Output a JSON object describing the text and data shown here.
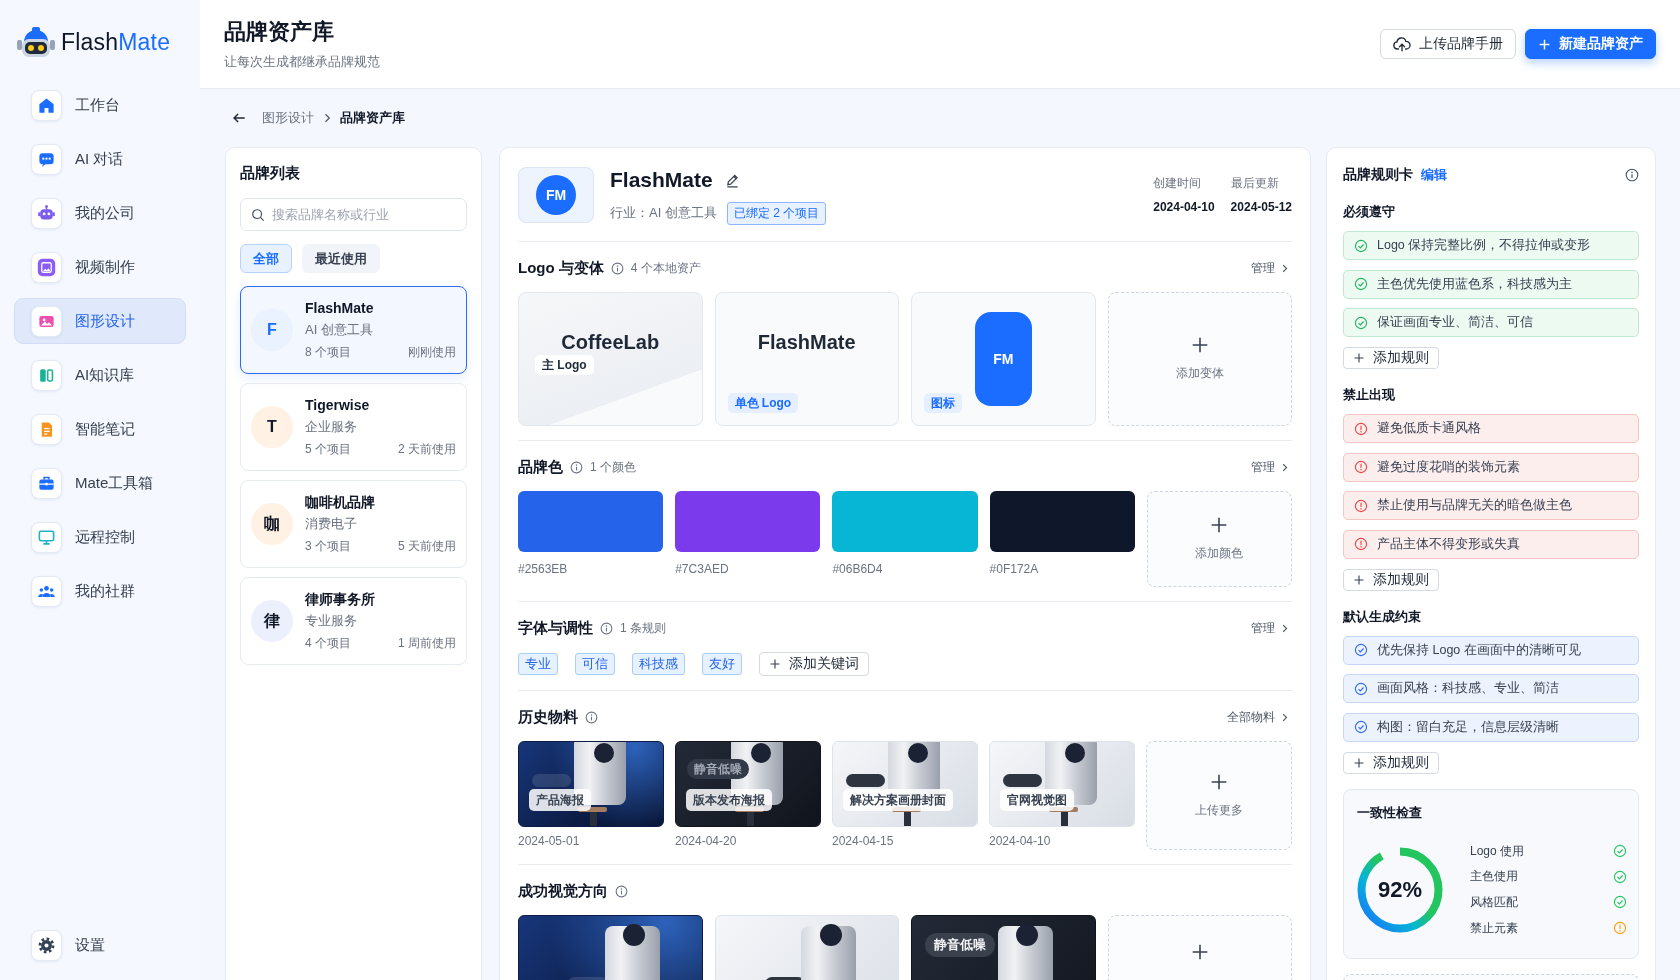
{
  "sidebar": {
    "logo": {
      "name_start": "Flash",
      "name_end": "Mate"
    },
    "items": [
      {
        "label": "工作台",
        "selected": false
      },
      {
        "label": "AI 对话",
        "selected": false
      },
      {
        "label": "我的公司",
        "selected": false
      },
      {
        "label": "视频制作",
        "selected": false
      },
      {
        "label": "图形设计",
        "selected": true
      },
      {
        "label": "AI知识库",
        "selected": false
      },
      {
        "label": "智能笔记",
        "selected": false
      },
      {
        "label": "Mate工具箱",
        "selected": false
      },
      {
        "label": "远程控制",
        "selected": false
      },
      {
        "label": "我的社群",
        "selected": false
      }
    ],
    "settings": {
      "label": "设置"
    }
  },
  "header": {
    "title": "品牌资产库",
    "subtitle": "让每次生成都继承品牌规范",
    "buttons": [
      {
        "kind": "upload",
        "label": "上传品牌手册"
      },
      {
        "kind": "create",
        "label": "新建品牌资产"
      }
    ]
  },
  "breadcrumb": [
    {
      "label": "图形设计",
      "current": false
    },
    {
      "label": "品牌资产库",
      "current": true
    }
  ],
  "brand_list": {
    "title": "品牌列表",
    "search": {
      "placeholder": "搜索品牌名称或行业"
    },
    "filters": [
      {
        "label": "全部",
        "selected": true
      },
      {
        "label": "最近使用",
        "selected": false
      }
    ],
    "brands": [
      {
        "initial": "F",
        "name": "FlashMate",
        "industry": "AI 创意工具",
        "projects": "8 个项目",
        "last_used": "刚刚使用",
        "color": "#eaf1ff",
        "selected": true
      },
      {
        "initial": "T",
        "name": "Tigerwise",
        "industry": "企业服务",
        "projects": "5 个项目",
        "last_used": "2 天前使用",
        "color": "#fff1e3",
        "selected": false
      },
      {
        "initial": "咖",
        "name": "咖啡机品牌",
        "industry": "消费电子",
        "projects": "3 个项目",
        "last_used": "5 天前使用",
        "color": "#fff1e3",
        "selected": false
      },
      {
        "initial": "律",
        "name": "律师事务所",
        "industry": "专业服务",
        "projects": "4 个项目",
        "last_used": "1 周前使用",
        "color": "#ecf0fc",
        "selected": false
      }
    ]
  },
  "brand_detail": {
    "logo": "FM",
    "name": "FlashMate",
    "industry": "行业：AI 创意工具",
    "badge": "已绑定 2 个项目",
    "meta": [
      {
        "label": "创建时间",
        "value": "2024-04-10"
      },
      {
        "label": "最后更新",
        "value": "2024-05-12"
      }
    ],
    "logo_variants": {
      "title": "Logo 与变体",
      "count": "4 个本地资产",
      "action": "管理",
      "items": [
        {
          "kind": "primary",
          "wordmark": "CoffeeLab",
          "tag": "主 Logo"
        },
        {
          "kind": "mono",
          "wordmark": "FlashMate",
          "tag": "单色 Logo"
        },
        {
          "kind": "icon",
          "wordmark": "FM",
          "tag": "图标"
        }
      ],
      "add_label": "添加变体"
    },
    "brand_colors": {
      "title": "品牌色",
      "count": "1 个颜色",
      "action": "管理",
      "items": [
        {
          "color": "#2563eb",
          "hex": "#2563EB"
        },
        {
          "color": "#7c3aed",
          "hex": "#7C3AED"
        },
        {
          "color": "#06b6d4",
          "hex": "#06B6D4"
        },
        {
          "color": "#0f172a",
          "hex": "#0F172A"
        }
      ],
      "add_label": "添加颜色"
    },
    "tone": {
      "title": "字体与调性",
      "count": "1 条规则",
      "action": "管理",
      "keywords": [
        "专业",
        "可信",
        "科技感",
        "友好"
      ],
      "add_label": "添加关键词"
    },
    "history": {
      "title": "历史物料",
      "action": "全部物料",
      "items": [
        {
          "kind": "navy",
          "label": "产品海报",
          "date": "2024-05-01"
        },
        {
          "kind": "dark",
          "label": "版本发布海报",
          "chip": "静音低噪",
          "date": "2024-04-20"
        },
        {
          "kind": "light",
          "label": "解决方案画册封面",
          "date": "2024-04-15"
        },
        {
          "kind": "light",
          "label": "官网视觉图",
          "date": "2024-04-10"
        }
      ],
      "add_label": "上传更多"
    },
    "directions": {
      "title": "成功视觉方向",
      "items": [
        {
          "kind": "navy"
        },
        {
          "kind": "light"
        },
        {
          "kind": "dark",
          "chip": "静音低噪"
        }
      ]
    }
  },
  "rule_card": {
    "title": "品牌规则卡",
    "edit": "编辑",
    "groups": [
      {
        "kind": "must",
        "title": "必须遵守",
        "rules": [
          "Logo 保持完整比例，不得拉伸或变形",
          "主色优先使用蓝色系，科技感为主",
          "保证画面专业、简洁、可信"
        ],
        "add_label": "添加规则"
      },
      {
        "kind": "forbid",
        "title": "禁止出现",
        "rules": [
          "避免低质卡通风格",
          "避免过度花哨的装饰元素",
          "禁止使用与品牌无关的暗色做主色",
          "产品主体不得变形或失真"
        ],
        "add_label": "添加规则"
      },
      {
        "kind": "default",
        "title": "默认生成约束",
        "rules": [
          "优先保持 Logo 在画面中的清晰可见",
          "画面风格：科技感、专业、简洁",
          "构图：留白充足，信息层级清晰"
        ],
        "add_label": "添加规则"
      }
    ],
    "consistency": {
      "title": "一致性检查",
      "score": "92%",
      "level": 0.92,
      "checks": [
        {
          "label": "Logo 使用",
          "passed": true
        },
        {
          "label": "主色使用",
          "passed": true
        },
        {
          "label": "风格匹配",
          "passed": true
        },
        {
          "label": "禁止元素",
          "passed": false
        }
      ]
    }
  }
}
